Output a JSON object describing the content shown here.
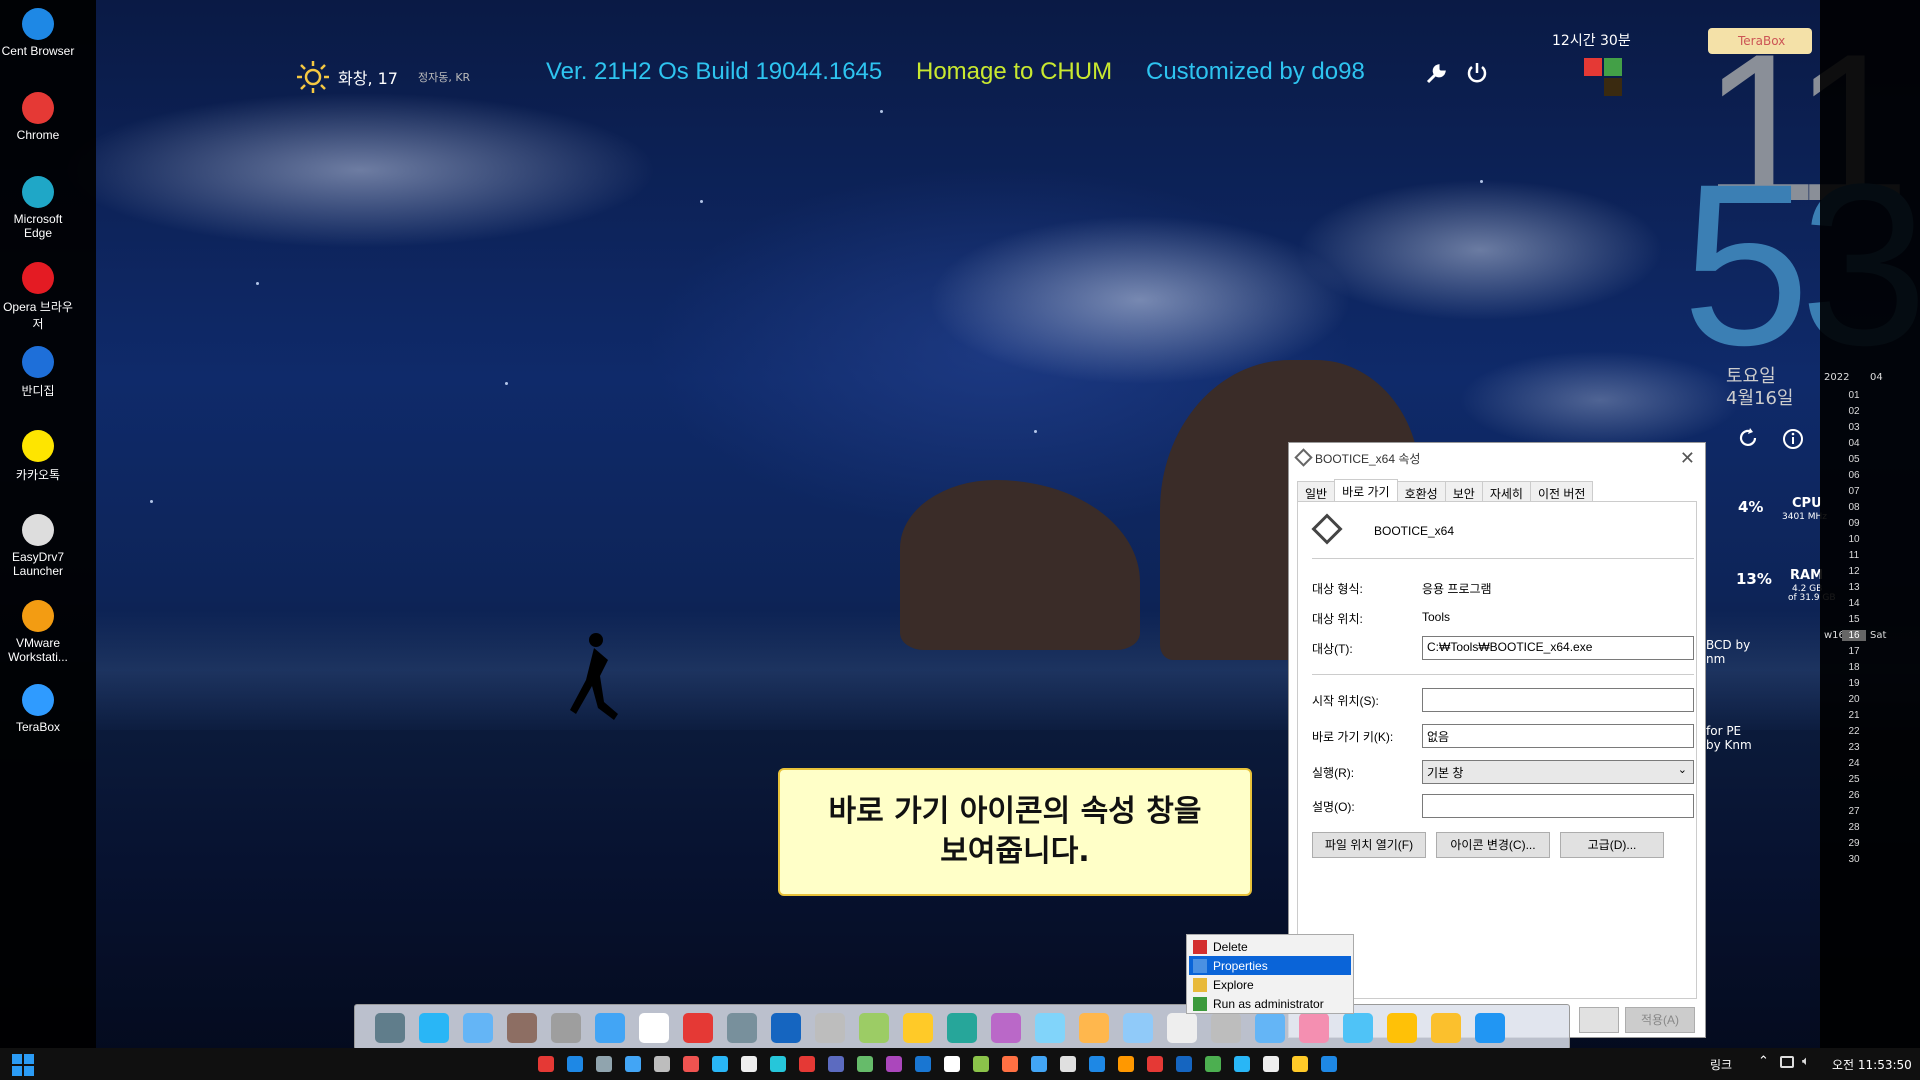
{
  "desktop_icons": [
    {
      "label": "Cent Browser",
      "icon": "cent-browser-icon",
      "color": "#1e88e5"
    },
    {
      "label": "Chrome",
      "icon": "chrome-icon",
      "color": "#e53935"
    },
    {
      "label": "Microsoft Edge",
      "icon": "edge-icon",
      "color": "#1fa7c7"
    },
    {
      "label": "Opera 브라우저",
      "icon": "opera-icon",
      "color": "#e41b23"
    },
    {
      "label": "반디집",
      "icon": "bandizip-icon",
      "color": "#1e6fd9"
    },
    {
      "label": "카카오톡",
      "icon": "kakaotalk-icon",
      "color": "#fee500"
    },
    {
      "label": "EasyDrv7 Launcher",
      "icon": "easydrv-icon",
      "color": "#dddddd"
    },
    {
      "label": "VMware Workstati...",
      "icon": "vmware-icon",
      "color": "#f39c12"
    },
    {
      "label": "TeraBox",
      "icon": "terabox-icon",
      "color": "#2f9bff"
    }
  ],
  "weather": {
    "location_temp": "화창, 17",
    "place": "정자동, KR"
  },
  "banner": {
    "version": "Ver. 21H2  Os Build 19044.1645",
    "homage": "Homage to CHUM",
    "customized": "Customized  by do98"
  },
  "timer_label": "12시간 30분",
  "terabox_badge": "TeraBox",
  "clock": {
    "hour": "11",
    "minute": "53",
    "weekday": "토요일",
    "date": "4월16일"
  },
  "calendar": {
    "year": "2022",
    "month": "04",
    "week": "w16",
    "today": "16",
    "today_day": "Sat",
    "days": [
      "01",
      "02",
      "03",
      "04",
      "05",
      "06",
      "07",
      "08",
      "09",
      "10",
      "11",
      "12",
      "13",
      "14",
      "15",
      "16",
      "17",
      "18",
      "19",
      "20",
      "21",
      "22",
      "23",
      "24",
      "25",
      "26",
      "27",
      "28",
      "29",
      "30"
    ]
  },
  "stats": {
    "cpu_percent": "4%",
    "cpu_label": "CPU",
    "cpu_freq": "3401 MHz",
    "ram_percent": "13%",
    "ram_label": "RAM",
    "ram_used": "4.2 GB",
    "ram_total": "of 31.9 GB"
  },
  "side_snippets": {
    "bcd": "BCD by",
    "bcd2": "nm",
    "pe": "for PE",
    "pe2": "by Knm"
  },
  "dialog": {
    "title": "BOOTICE_x64 속성",
    "tabs": [
      "일반",
      "바로 가기",
      "호환성",
      "보안",
      "자세히",
      "이전 버전"
    ],
    "active_tab": "바로 가기",
    "app_name": "BOOTICE_x64",
    "target_type_label": "대상 형식:",
    "target_type": "응용 프로그램",
    "target_location_label": "대상 위치:",
    "target_location": "Tools",
    "target_label": "대상(T):",
    "target_value": "C:₩Tools₩BOOTICE_x64.exe",
    "start_in_label": "시작 위치(S):",
    "start_in_value": "",
    "shortcut_key_label": "바로 가기 키(K):",
    "shortcut_key_value": "없음",
    "run_label": "실행(R):",
    "run_value": "기본 창",
    "comment_label": "설명(O):",
    "comment_value": "",
    "btn_open_location": "파일 위치 열기(F)",
    "btn_change_icon": "아이콘 변경(C)...",
    "btn_advanced": "고급(D)...",
    "btn_apply": "적용(A)"
  },
  "context_menu": {
    "items": [
      {
        "label": "Delete",
        "icon": "delete-icon",
        "color": "#d32f2f"
      },
      {
        "label": "Properties",
        "icon": "properties-icon",
        "color": "#4a90e2"
      },
      {
        "label": "Explore",
        "icon": "folder-icon",
        "color": "#e8b93a"
      },
      {
        "label": "Run as administrator",
        "icon": "shield-icon",
        "color": "#3c9a3c"
      }
    ],
    "selected": 1
  },
  "callout": {
    "line1": "바로 가기 아이콘의 속성 창을",
    "line2": "보여줍니다."
  },
  "dock_colors": [
    "#607d8b",
    "#29b6f6",
    "#64b5f6",
    "#8d6e63",
    "#9e9e9e",
    "#42a5f5",
    "#ffffff",
    "#e53935",
    "#78909c",
    "#1565c0",
    "#bdbdbd",
    "#9ccc65",
    "#ffca28",
    "#26a69a",
    "#ba68c8",
    "#81d4fa",
    "#ffb74d",
    "#90caf9",
    "#eeeeee",
    "#bdbdbd",
    "#64b5f6",
    "#f48fb1",
    "#4fc3f7",
    "#ffc107",
    "#fbc02d",
    "#2196f3"
  ],
  "tray": {
    "link_label": "링크",
    "time": "오전 11:53:50"
  }
}
